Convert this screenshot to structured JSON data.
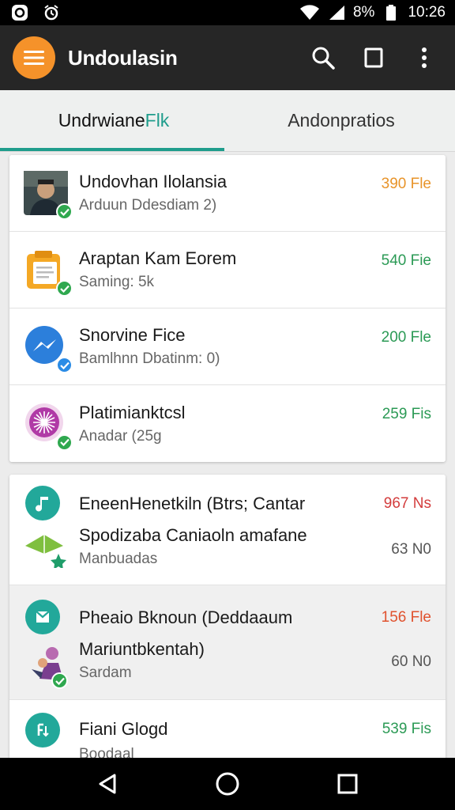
{
  "status_bar": {
    "battery_percent": "8%",
    "time": "10:26"
  },
  "app_bar": {
    "title": "Undoulasin"
  },
  "tabs": [
    {
      "label_main": "Undrwiane",
      "label_accent": "Flk",
      "active": true
    },
    {
      "label": "Andonpratios",
      "active": false
    }
  ],
  "list1": [
    {
      "title": "Undovhan Ilolansia",
      "subtitle": "Arduun Ddesdiam 2)",
      "size": "390 Fle",
      "size_color": "#e8942a",
      "icon": "user-photo-icon",
      "badge": "green"
    },
    {
      "title": "Araptan Kam Eorem",
      "subtitle": "Saming: 5k",
      "size": "540 Fie",
      "size_color": "#2b9a55",
      "icon": "clipboard-icon",
      "badge": "green"
    },
    {
      "title": "Snorvine Fice",
      "subtitle": "Bamlhnn Dbatinm: 0)",
      "size": "200 Fle",
      "size_color": "#2b9a55",
      "icon": "messenger-icon",
      "badge": "blue"
    },
    {
      "title": "Platimianktcsl",
      "subtitle": "Anadar (25g",
      "size": "259 Fis",
      "size_color": "#2b9a55",
      "icon": "sparkle-icon",
      "badge": "green"
    }
  ],
  "list2": [
    {
      "line1": "EneenHenetkiln (Btrs; Cantar",
      "line2": "Spodizaba Caniaoln amafane",
      "sub": "Manbuadas",
      "right1": "967 Ns",
      "right1_color": "#d33c3c",
      "right2": "63 N0"
    },
    {
      "line1": "Pheaio Bknoun (Deddaaum",
      "line2": "Mariuntbkentah)",
      "sub": "Sardam",
      "right1": "156 Fle",
      "right1_color": "#e0522e",
      "right2": "60 N0"
    },
    {
      "line1": "Fiani Glogd",
      "line2": "",
      "sub": "Boodaal",
      "right1": "539 Fis",
      "right1_color": "#2b9a55",
      "right2": ""
    }
  ]
}
